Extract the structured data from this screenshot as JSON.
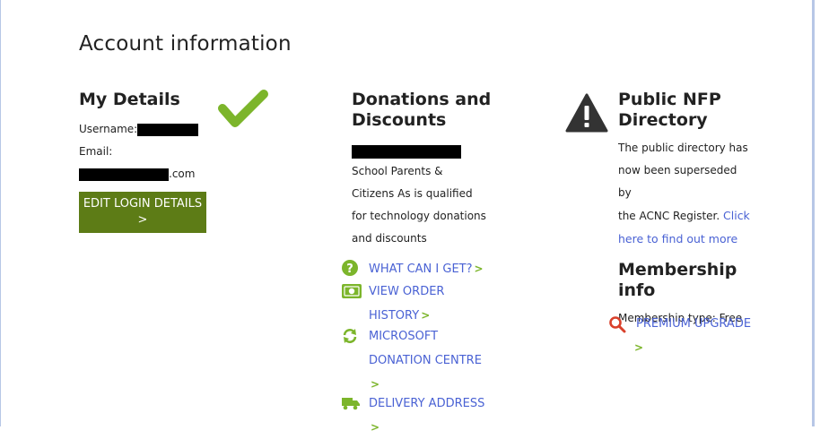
{
  "page_title": "Account information",
  "my_details": {
    "heading": "My Details",
    "username_label": "Username:",
    "email_label": "Email:",
    "email_suffix": ".com",
    "edit_button_line1": "EDIT LOGIN DETAILS",
    "edit_button_line2": ">"
  },
  "donations": {
    "heading_line1": "Donations and",
    "heading_line2": "Discounts",
    "desc_lines": [
      "School Parents &",
      "Citizens As is qualified",
      "for technology donations",
      "and discounts"
    ],
    "actions": [
      {
        "line1": "WHAT CAN I GET?",
        "line2": "",
        "icon": "question-circle-icon"
      },
      {
        "line1": "VIEW ORDER",
        "line2": "HISTORY",
        "icon": "money-icon"
      },
      {
        "line1": "MICROSOFT",
        "line2": "DONATION CENTRE",
        "icon": "refresh-icon"
      },
      {
        "line1": "DELIVERY ADDRESS",
        "line2": "",
        "icon": "truck-icon"
      }
    ],
    "chevron": ">"
  },
  "public_nfp": {
    "heading_line1": "Public NFP",
    "heading_line2": "Directory",
    "desc_lines": [
      "The public directory has",
      "now been superseded by"
    ],
    "desc_last_prefix": "the ACNC Register.",
    "link_part1": "Click",
    "link_part2": "here to find out more"
  },
  "membership": {
    "heading_line1": "Membership",
    "heading_line2": "info",
    "type_text": "Membership type: Free",
    "upgrade_label": "PREMIUM UPGRADE",
    "chevron": ">"
  },
  "colors": {
    "accent_green": "#5d7c16",
    "check_green": "#7cb52b",
    "link_blue": "#4a62d4",
    "search_red": "#d9402b"
  }
}
